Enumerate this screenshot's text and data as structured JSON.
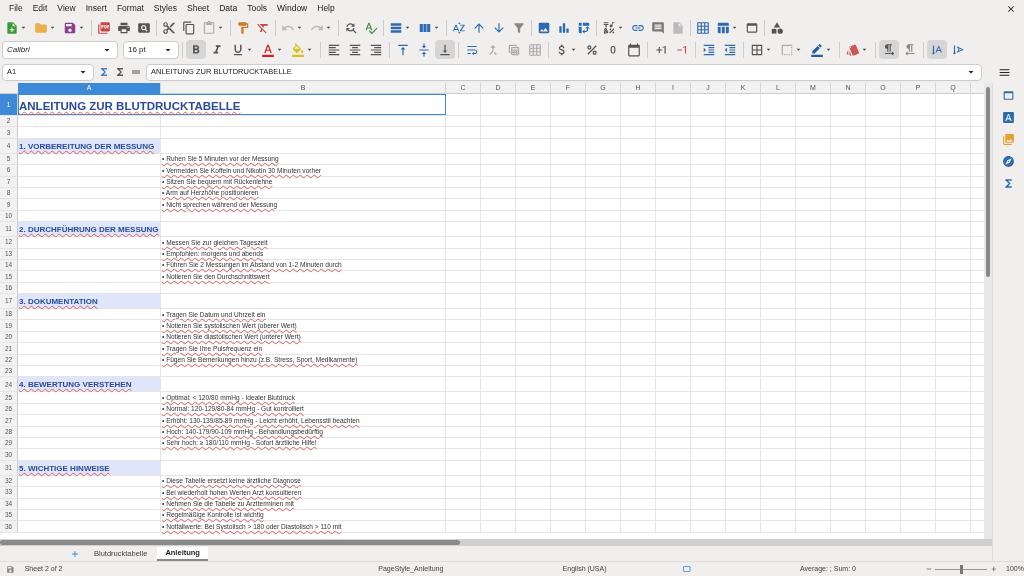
{
  "menu": [
    "File",
    "Edit",
    "View",
    "Insert",
    "Format",
    "Styles",
    "Sheet",
    "Data",
    "Tools",
    "Window",
    "Help"
  ],
  "format_toolbar": {
    "font_name": "Calibri",
    "font_size": "16 pt",
    "bold": true,
    "italic": false,
    "underline": false,
    "align_bottom": true,
    "left_to_right": true,
    "stacked_text": true
  },
  "name_box": "A1",
  "formula": "ANLEITUNG ZUR BLUTDRUCKTABELLE",
  "columns": [
    {
      "label": "A",
      "selected": true
    },
    {
      "label": "B",
      "selected": false
    },
    {
      "label": "C",
      "selected": false
    },
    {
      "label": "D",
      "selected": false
    },
    {
      "label": "E",
      "selected": false
    },
    {
      "label": "F",
      "selected": false
    },
    {
      "label": "G",
      "selected": false
    },
    {
      "label": "H",
      "selected": false
    },
    {
      "label": "I",
      "selected": false
    },
    {
      "label": "J",
      "selected": false
    },
    {
      "label": "K",
      "selected": false
    },
    {
      "label": "L",
      "selected": false
    },
    {
      "label": "M",
      "selected": false
    },
    {
      "label": "N",
      "selected": false
    },
    {
      "label": "O",
      "selected": false
    },
    {
      "label": "P",
      "selected": false
    },
    {
      "label": "Q",
      "selected": false
    }
  ],
  "rows": [
    {
      "number": "1",
      "kind": "title",
      "text": "ANLEITUNG ZUR BLUTDRUCKTABELLE",
      "selected": true
    },
    {
      "number": "2",
      "kind": "empty",
      "selected": false
    },
    {
      "number": "3",
      "kind": "empty",
      "selected": false
    },
    {
      "number": "4",
      "kind": "heading",
      "text": "1. VORBEREITUNG DER MESSUNG",
      "selected": false
    },
    {
      "number": "5",
      "kind": "bullet",
      "text": "• Ruhen Sie 5 Minuten vor der Messung",
      "selected": false
    },
    {
      "number": "6",
      "kind": "bullet",
      "text": "• Vermeiden Sie Koffein und Nikotin 30 Minuten vorher",
      "selected": false
    },
    {
      "number": "7",
      "kind": "bullet",
      "text": "• Sitzen Sie bequem mit Rückenlehne",
      "selected": false
    },
    {
      "number": "8",
      "kind": "bullet",
      "text": "• Arm auf Herzhöhe positionieren",
      "selected": false
    },
    {
      "number": "9",
      "kind": "bullet",
      "text": "• Nicht sprechen während der Messung",
      "selected": false
    },
    {
      "number": "10",
      "kind": "empty",
      "selected": false
    },
    {
      "number": "11",
      "kind": "heading",
      "text": "2. DURCHFÜHRUNG DER MESSUNG",
      "selected": false
    },
    {
      "number": "12",
      "kind": "bullet",
      "text": "• Messen Sie zur gleichen Tageszeit",
      "selected": false
    },
    {
      "number": "13",
      "kind": "bullet",
      "text": "• Empfohlen: morgens und abends",
      "selected": false
    },
    {
      "number": "14",
      "kind": "bullet",
      "text": "• Führen Sie 2 Messungen im Abstand von 1-2 Minuten durch",
      "selected": false
    },
    {
      "number": "15",
      "kind": "bullet",
      "text": "• Notieren Sie den Durchschnittswert",
      "selected": false
    },
    {
      "number": "16",
      "kind": "empty",
      "selected": false
    },
    {
      "number": "17",
      "kind": "heading",
      "text": "3. DOKUMENTATION",
      "selected": false
    },
    {
      "number": "18",
      "kind": "bullet",
      "text": "• Tragen Sie Datum und Uhrzeit ein",
      "selected": false
    },
    {
      "number": "19",
      "kind": "bullet",
      "text": "• Notieren Sie systolischen Wert (oberer Wert)",
      "selected": false
    },
    {
      "number": "20",
      "kind": "bullet",
      "text": "• Notieren Sie diastolischen Wert (unterer Wert)",
      "selected": false
    },
    {
      "number": "21",
      "kind": "bullet",
      "text": "• Tragen Sie Ihre Pulsfrequenz ein",
      "selected": false
    },
    {
      "number": "22",
      "kind": "bullet",
      "text": "• Fügen Sie Bemerkungen hinzu (z.B. Stress, Sport, Medikamente)",
      "selected": false
    },
    {
      "number": "23",
      "kind": "empty",
      "selected": false
    },
    {
      "number": "24",
      "kind": "heading",
      "text": "4. BEWERTUNG VERSTEHEN",
      "selected": false
    },
    {
      "number": "25",
      "kind": "bullet",
      "text": "• Optimal: < 120/80 mmHg - Idealer Blutdruck",
      "selected": false
    },
    {
      "number": "26",
      "kind": "bullet",
      "text": "• Normal: 120-129/80-84 mmHg - Gut kontrolliert",
      "selected": false
    },
    {
      "number": "27",
      "kind": "bullet",
      "text": "• Erhöht: 130-139/85-89 mmHg - Leicht erhöht, Lebensstil beachten",
      "selected": false
    },
    {
      "number": "28",
      "kind": "bullet",
      "text": "• Hoch: 140-179/90-109 mmHg - Behandlungsbedürftig",
      "selected": false
    },
    {
      "number": "29",
      "kind": "bullet",
      "text": "• Sehr hoch: ≥ 180/110 mmHg - Sofort ärztliche Hilfe!",
      "selected": false
    },
    {
      "number": "30",
      "kind": "empty",
      "selected": false
    },
    {
      "number": "31",
      "kind": "heading",
      "text": "5. WICHTIGE HINWEISE",
      "selected": false
    },
    {
      "number": "32",
      "kind": "bullet",
      "text": "• Diese Tabelle ersetzt keine ärztliche Diagnose",
      "selected": false
    },
    {
      "number": "33",
      "kind": "bullet",
      "text": "• Bei wiederholt hohen Werten Arzt konsultieren",
      "selected": false
    },
    {
      "number": "34",
      "kind": "bullet",
      "text": "• Nehmen Sie die Tabelle zu Arztterminen mit",
      "selected": false
    },
    {
      "number": "35",
      "kind": "bullet",
      "text": "• Regelmäßige Kontrolle ist wichtig",
      "selected": false
    },
    {
      "number": "36",
      "kind": "bullet",
      "text": "• Notfallwerte: Bei Systolisch > 180 oder Diastolisch > 110 mit",
      "selected": false
    }
  ],
  "sheet_tabs": [
    {
      "label": "Blutdrucktabelle",
      "selected": false
    },
    {
      "label": "Anleitung",
      "selected": true
    }
  ],
  "status_bar": {
    "sheet": "Sheet 2 of 2",
    "page_style": "PageStyle_Anleitung",
    "language": "English (USA)",
    "summary": "Average: ; Sum: 0",
    "zoom": "100%",
    "zoom_slider": {
      "level": 0.5
    }
  }
}
